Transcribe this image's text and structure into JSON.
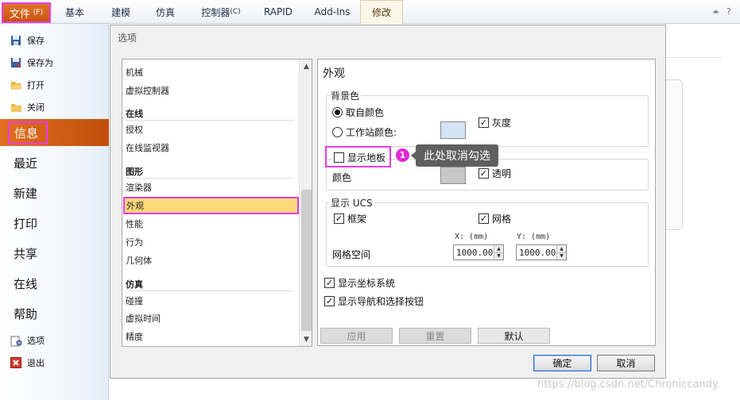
{
  "ribbon": {
    "file_tab": {
      "label": "文件",
      "shortcut": "(F)"
    },
    "tabs": [
      {
        "label": "基本"
      },
      {
        "label": "建模"
      },
      {
        "label": "仿真"
      },
      {
        "label": "控制器",
        "shortcut": "(C)"
      },
      {
        "label": "RAPID"
      },
      {
        "label": "Add-Ins"
      },
      {
        "label": "修改"
      }
    ],
    "controls": {
      "collapse": "⏶",
      "help": "?"
    }
  },
  "backstage": {
    "small_top": [
      {
        "label": "保存",
        "icon": "save-icon"
      },
      {
        "label": "保存为",
        "icon": "save-as-icon"
      },
      {
        "label": "打开",
        "icon": "open-folder-icon"
      },
      {
        "label": "关闭",
        "icon": "close-folder-icon"
      }
    ],
    "big_items": [
      {
        "label": "信息"
      },
      {
        "label": "最近"
      },
      {
        "label": "新建"
      },
      {
        "label": "打印"
      },
      {
        "label": "共享"
      },
      {
        "label": "在线"
      },
      {
        "label": "帮助"
      }
    ],
    "small_bottom": [
      {
        "label": "选项",
        "icon": "options-icon"
      },
      {
        "label": "退出",
        "icon": "exit-icon"
      }
    ]
  },
  "dialog": {
    "title": "选项",
    "nav": {
      "items": [
        {
          "label": "机械"
        },
        {
          "label": "虚拟控制器"
        },
        {
          "label": "在线"
        },
        {
          "label": "授权"
        },
        {
          "label": "在线监视器"
        },
        {
          "label": "图形"
        },
        {
          "label": "渲染器"
        },
        {
          "label": "外观"
        },
        {
          "label": "性能"
        },
        {
          "label": "行为"
        },
        {
          "label": "几何体"
        },
        {
          "label": "仿真"
        },
        {
          "label": "碰撞"
        },
        {
          "label": "虚拟时间"
        },
        {
          "label": "精度"
        }
      ]
    },
    "panel": {
      "title": "外观",
      "background_group": {
        "label": "背景色",
        "radio_from_color": "取自颜色",
        "radio_station_color": "工作站颜色:",
        "gray_label": "灰度",
        "gray_checked": true
      },
      "floor_group": {
        "show_floor_label": "显示地板",
        "show_floor_checked": false,
        "color_label": "颜色",
        "transparent_label": "透明",
        "transparent_checked": true
      },
      "ucs_group": {
        "label": "显示 UCS",
        "frame_label": "框架",
        "frame_checked": true,
        "grid_label": "网格",
        "grid_checked": true,
        "grid_space_label": "网格空间",
        "x_label": "X: (mm)",
        "y_label": "Y: (mm)",
        "x_value": "1000.00",
        "y_value": "1000.00"
      },
      "show_coord_label": "显示坐标系统",
      "show_coord_checked": true,
      "show_nav_label": "显示导航和选择按钮",
      "show_nav_checked": true,
      "buttons": {
        "apply": "应用",
        "reset": "重置",
        "default": "默认"
      }
    },
    "ok": "确定",
    "cancel": "取消"
  },
  "callout": {
    "badge": "1",
    "text": "此处取消勾选"
  },
  "watermark": "https://blog.csdn.net/Chroniccandy",
  "colors": {
    "accent_orange": "#d35f16",
    "highlight_magenta": "#e83be8",
    "selection_yellow": "#fbd97a",
    "station_swatch": "#d6e4f7",
    "floor_swatch": "#c8c8c8"
  }
}
